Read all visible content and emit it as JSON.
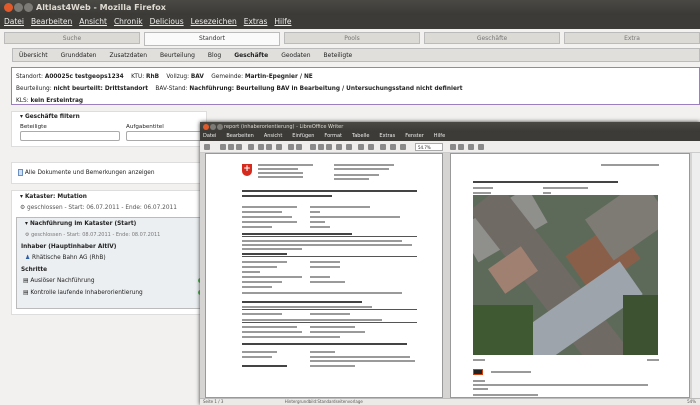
{
  "firefox": {
    "title": "Altlast4Web - Mozilla Firefox",
    "menu": [
      "Datei",
      "Bearbeiten",
      "Ansicht",
      "Chronik",
      "Delicious",
      "Lesezeichen",
      "Extras",
      "Hilfe"
    ],
    "tabs": [
      "Suche",
      "Standort",
      "Pools",
      "Geschäfte",
      "Extra"
    ],
    "active_tab": "Standort",
    "subtabs": [
      "Übersicht",
      "Grunddaten",
      "Zusatzdaten",
      "Beurteilung",
      "Blog",
      "Geschäfte",
      "Geodaten",
      "Beteiligte"
    ],
    "active_subtab": "Geschäfte",
    "info": {
      "standort_label": "Standort:",
      "standort": "A00025c testgeops1234",
      "ktu_label": "KTU:",
      "ktu": "RhB",
      "vollzug_label": "Vollzug:",
      "vollzug": "BAV",
      "gemeinde_label": "Gemeinde:",
      "gemeinde": "Martin-Epegnier / NE",
      "beurteilung_label": "Beurteilung:",
      "beurteilung": "nicht beurteilt: Drittstandort",
      "bav_label": "BAV-Stand:",
      "bav": "Nachführung: Beurteilung BAV in Bearbeitung / Untersuchungsstand nicht definiert",
      "kls_label": "KLS:",
      "kls": "kein Ersteintrag"
    },
    "filter": {
      "title": "Geschäfte filtern",
      "beteiligte_label": "Beteiligte",
      "aufgabentitel_label": "Aufgabentitel",
      "beteiligte_value": "",
      "aufgabentitel_value": ""
    },
    "docs_link": "Alle Dokumente und Bemerkungen anzeigen",
    "kataster": {
      "title": "Kataster: Mutation",
      "status": "geschlossen - Start: 06.07.2011 - Ende: 06.07.2011",
      "sub_title": "Nachführung im Kataster (Start)",
      "sub_status": "geschlossen - Start: 08.07.2011 - Ende: 08.07.2011",
      "inhaber_title": "Inhaber (Hauptinhaber AltIV)",
      "inhaber": "Rhätische Bahn AG (RhB)",
      "schritte_title": "Schritte",
      "schritte": [
        "Auslöser Nachführung",
        "Kontrolle laufende Inhaberorientierung"
      ]
    }
  },
  "writer": {
    "title": "report (inhaberorientierung) - LibreOffice Writer",
    "menu": [
      "Datei",
      "Bearbeiten",
      "Ansicht",
      "Einfügen",
      "Format",
      "Tabelle",
      "Extras",
      "Fenster",
      "Hilfe"
    ],
    "zoom": "54.7%",
    "status_page": "Seite 1 / 3",
    "status_style": "Hintergrundbild:Standardseitenvorlage",
    "status_zoom": "54%"
  },
  "colors": {
    "accent": "#9b7fc0",
    "titlebar": "#3c3b37",
    "ok": "#4bb04b",
    "close": "#e05a2b"
  }
}
